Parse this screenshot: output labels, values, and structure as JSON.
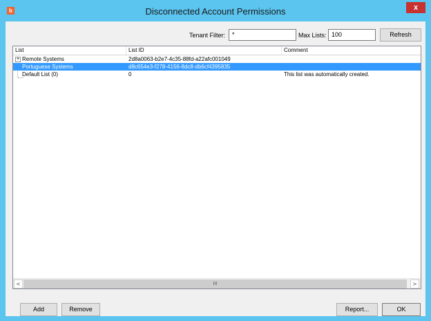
{
  "window": {
    "title": "Disconnected Account Permissions",
    "app_icon_glyph": "b",
    "close_glyph": "x",
    "accent": "#5bc4ef"
  },
  "filters": {
    "tenant_filter_label": "Tenant Filter:",
    "tenant_filter_value": "*",
    "max_lists_label": "Max Lists:",
    "max_lists_value": "100",
    "refresh_label": "Refresh"
  },
  "grid": {
    "columns": [
      "List",
      "List ID",
      "Comment"
    ],
    "rows": [
      {
        "list": "Remote Systems",
        "list_id": "2d8a0063-b2e7-4c35-88fd-a22afc001049",
        "comment": "",
        "expandable": true,
        "selected": false
      },
      {
        "list": "Portuguese Systems",
        "list_id": "d8c654e3-f278-4156-8dc8-db6cf4395835",
        "comment": "",
        "expandable": false,
        "selected": true
      },
      {
        "list": "Default List (0)",
        "list_id": "0",
        "comment": "This list was automatically created.",
        "expandable": false,
        "selected": false
      }
    ],
    "expander_glyph": "+",
    "selected_color": "#3399ff",
    "scroll_left_glyph": "<",
    "scroll_right_glyph": ">",
    "scroll_thumb_grip": "III"
  },
  "footer": {
    "add_label": "Add",
    "remove_label": "Remove",
    "report_label": "Report...",
    "ok_label": "OK"
  }
}
